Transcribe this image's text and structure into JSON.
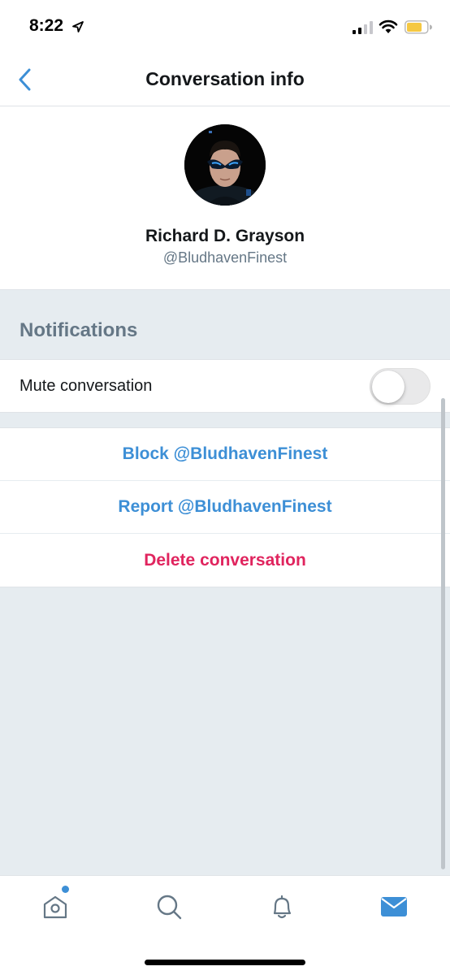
{
  "status_bar": {
    "time": "8:22",
    "icons": [
      "location-arrow-icon",
      "cellular-signal-icon",
      "wifi-icon",
      "battery-icon"
    ]
  },
  "nav": {
    "back_icon": "chevron-left-icon",
    "title": "Conversation info"
  },
  "profile": {
    "name": "Richard D. Grayson",
    "handle": "@BludhavenFinest"
  },
  "notifications": {
    "section_title": "Notifications",
    "mute_label": "Mute conversation",
    "mute_enabled": false
  },
  "actions": {
    "block": "Block @BludhavenFinest",
    "report": "Report @BludhavenFinest",
    "delete": "Delete conversation"
  },
  "tabs": [
    {
      "icon": "home-icon",
      "selected": false,
      "badge": true
    },
    {
      "icon": "search-icon",
      "selected": false
    },
    {
      "icon": "bell-icon",
      "selected": false
    },
    {
      "icon": "mail-icon",
      "selected": true
    }
  ],
  "colors": {
    "accent": "#3d8fd6",
    "danger": "#e0245e",
    "secondary_text": "#657786",
    "background": "#e6ecf0"
  }
}
